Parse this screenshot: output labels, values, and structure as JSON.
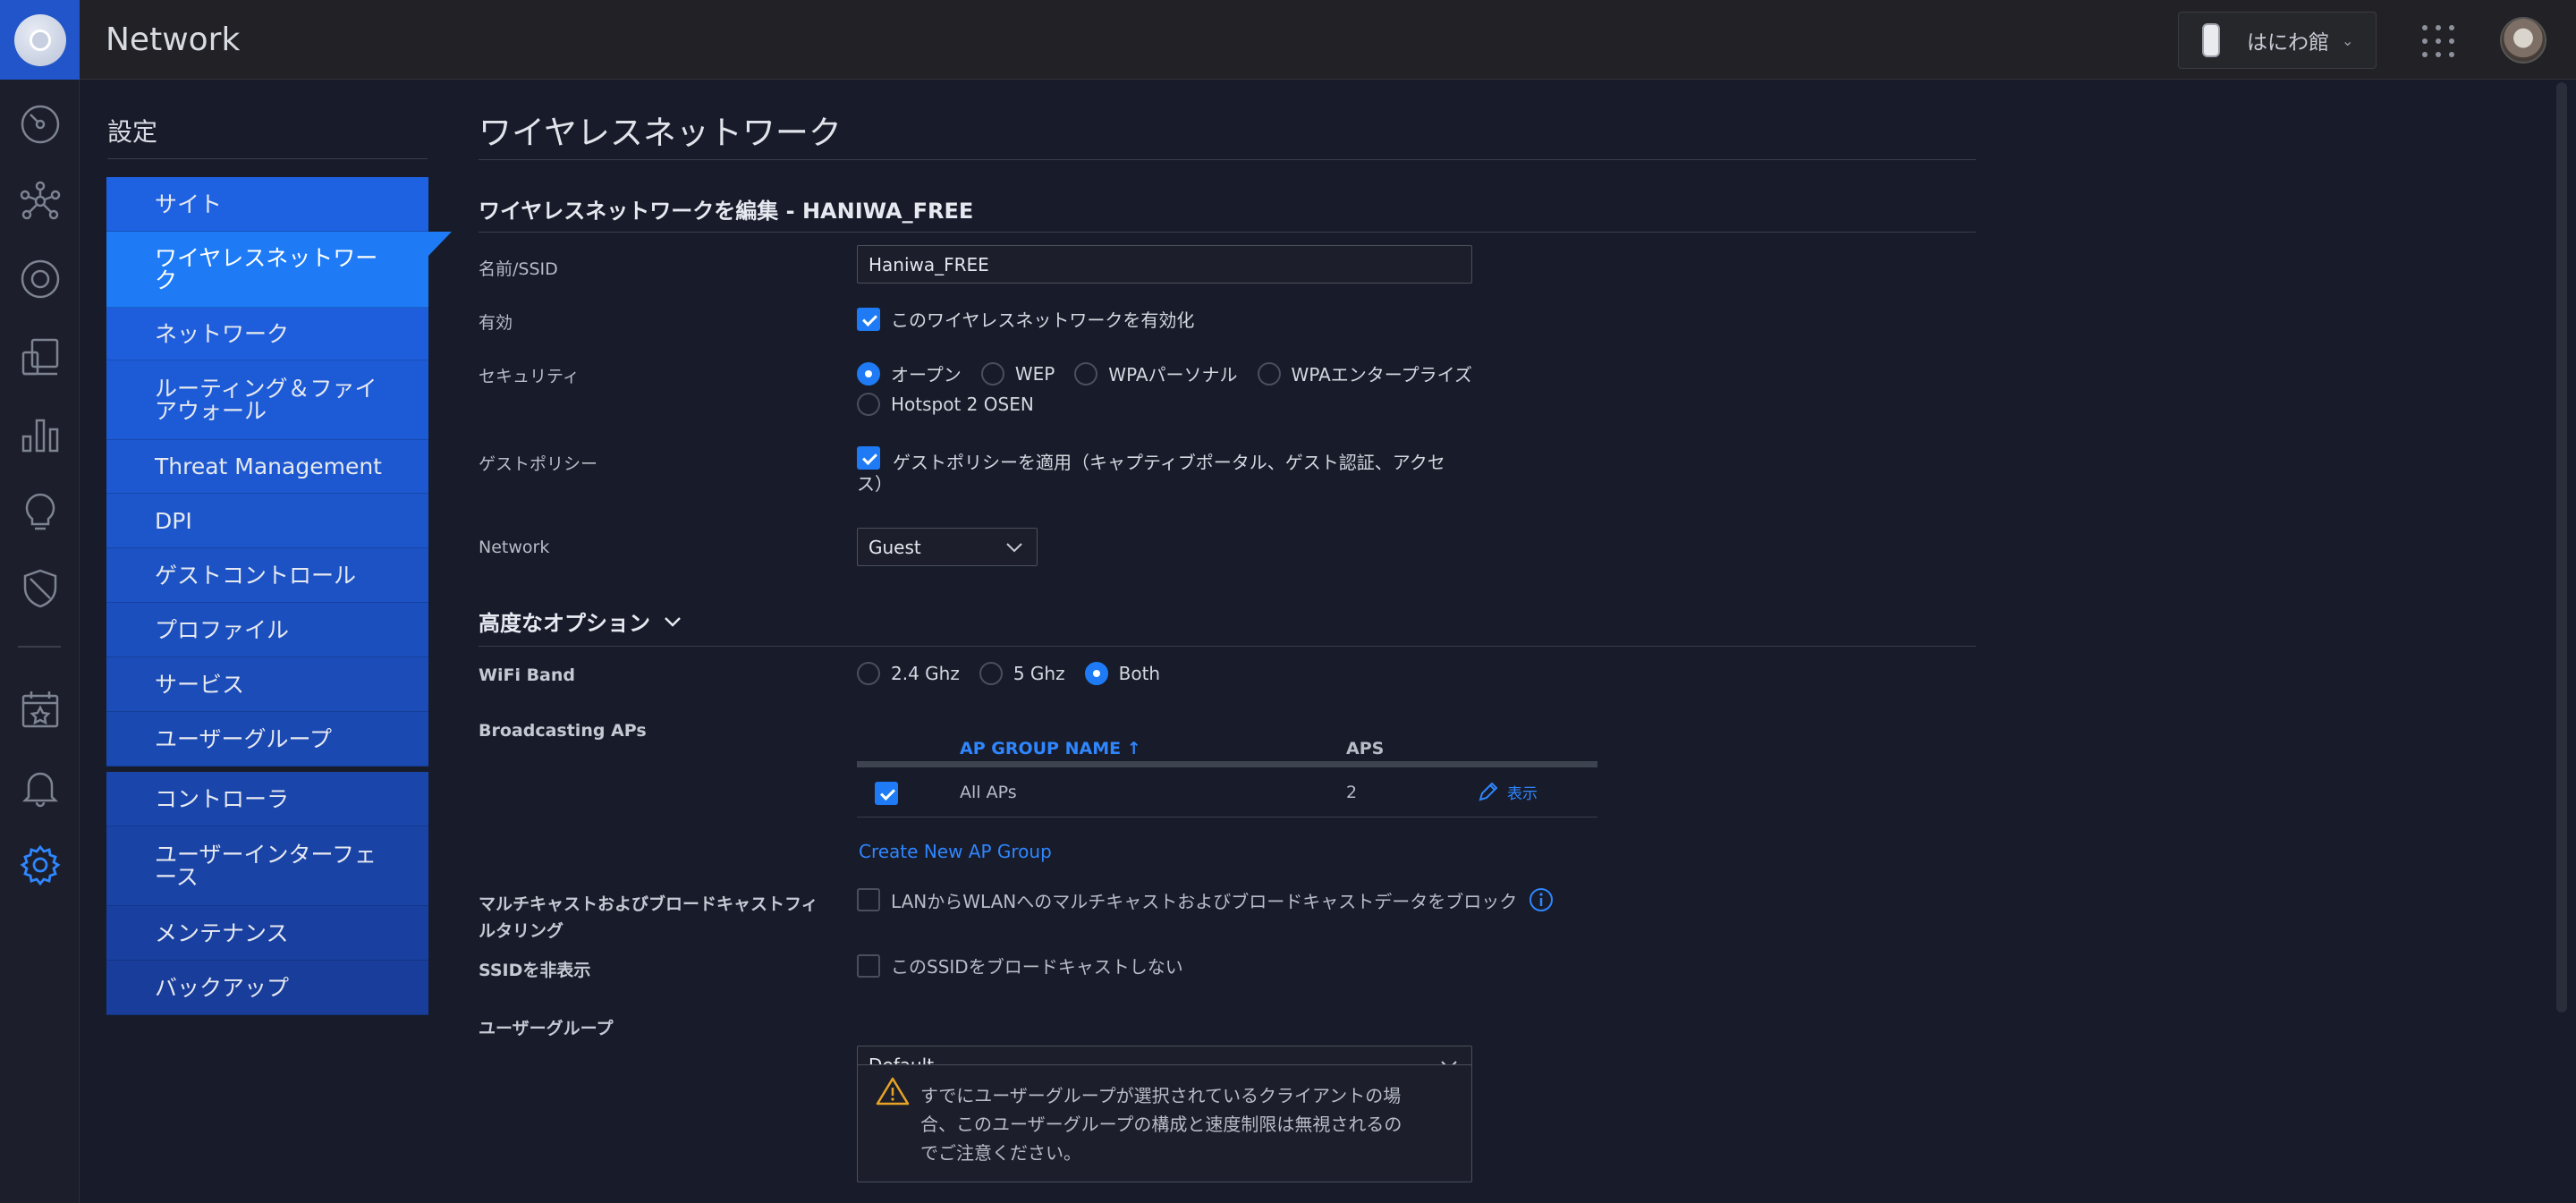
{
  "app": {
    "title": "Network"
  },
  "header": {
    "site_name": "はにわ館"
  },
  "rail_icons": [
    "dashboard-icon",
    "topology-icon",
    "devices-icon",
    "clients-icon",
    "statistics-icon",
    "insights-icon",
    "security-shield-icon",
    "events-calendar-icon",
    "alerts-bell-icon",
    "settings-gear-icon"
  ],
  "settings": {
    "title": "設定",
    "nav_group1": [
      {
        "label": "サイト"
      },
      {
        "label": "ワイヤレスネットワーク",
        "active": true
      },
      {
        "label": "ネットワーク"
      },
      {
        "label": "ルーティング＆ファイアウォール"
      },
      {
        "label": "Threat Management"
      },
      {
        "label": "DPI"
      },
      {
        "label": "ゲストコントロール"
      },
      {
        "label": "プロファイル"
      },
      {
        "label": "サービス"
      },
      {
        "label": "ユーザーグループ"
      }
    ],
    "nav_group2": [
      {
        "label": "コントローラ"
      },
      {
        "label": "ユーザーインターフェース"
      },
      {
        "label": "メンテナンス"
      },
      {
        "label": "バックアップ"
      }
    ]
  },
  "page": {
    "title": "ワイヤレスネットワーク",
    "edit_title": "ワイヤレスネットワークを編集 - HANIWA_FREE"
  },
  "form": {
    "ssid": {
      "label": "名前/SSID",
      "value": "Haniwa_FREE"
    },
    "enabled": {
      "label": "有効",
      "option": "このワイヤレスネットワークを有効化",
      "checked": true
    },
    "security": {
      "label": "セキュリティ",
      "options": [
        "オープン",
        "WEP",
        "WPAパーソナル",
        "WPAエンタープライズ",
        "Hotspot 2 OSEN"
      ],
      "selected": "オープン"
    },
    "guest_policy": {
      "label": "ゲストポリシー",
      "option_line1": "ゲストポリシーを適用（キャプティブポータル、ゲスト認証、アクセ",
      "option_line2": "ス）",
      "checked": true
    },
    "network": {
      "label": "Network",
      "value": "Guest"
    }
  },
  "advanced": {
    "title": "高度なオプション",
    "wifi_band": {
      "label": "WiFi Band",
      "options": [
        "2.4 Ghz",
        "5 Ghz",
        "Both"
      ],
      "selected": "Both"
    },
    "broadcasting_aps": {
      "label": "Broadcasting APs",
      "columns": [
        "AP GROUP NAME",
        "APS"
      ],
      "rows": [
        {
          "name": "All APs",
          "aps": "2",
          "action": "表示",
          "checked": true
        }
      ],
      "create_link": "Create New AP Group"
    },
    "multicast": {
      "label_line1": "マルチキャストおよびブロードキャストフィ",
      "label_line2": "ルタリング",
      "option": "LANからWLANへのマルチキャストおよびブロードキャストデータをブロック",
      "checked": false
    },
    "hide_ssid": {
      "label": "SSIDを非表示",
      "option": "このSSIDをブロードキャストしない",
      "checked": false
    },
    "user_group": {
      "label": "ユーザーグループ",
      "value": "Default",
      "warning_line1": "すでにユーザーグループが選択されているクライアントの場",
      "warning_line2": "合、このユーザーグループの構成と速度制限は無視されるの",
      "warning_line3": "でご注意ください。"
    }
  },
  "colors": {
    "accent": "#1e7bf5",
    "nav_bg": "#1d4fb8",
    "background": "#181c2a",
    "topbar": "#222226",
    "warning": "#e8a325"
  }
}
